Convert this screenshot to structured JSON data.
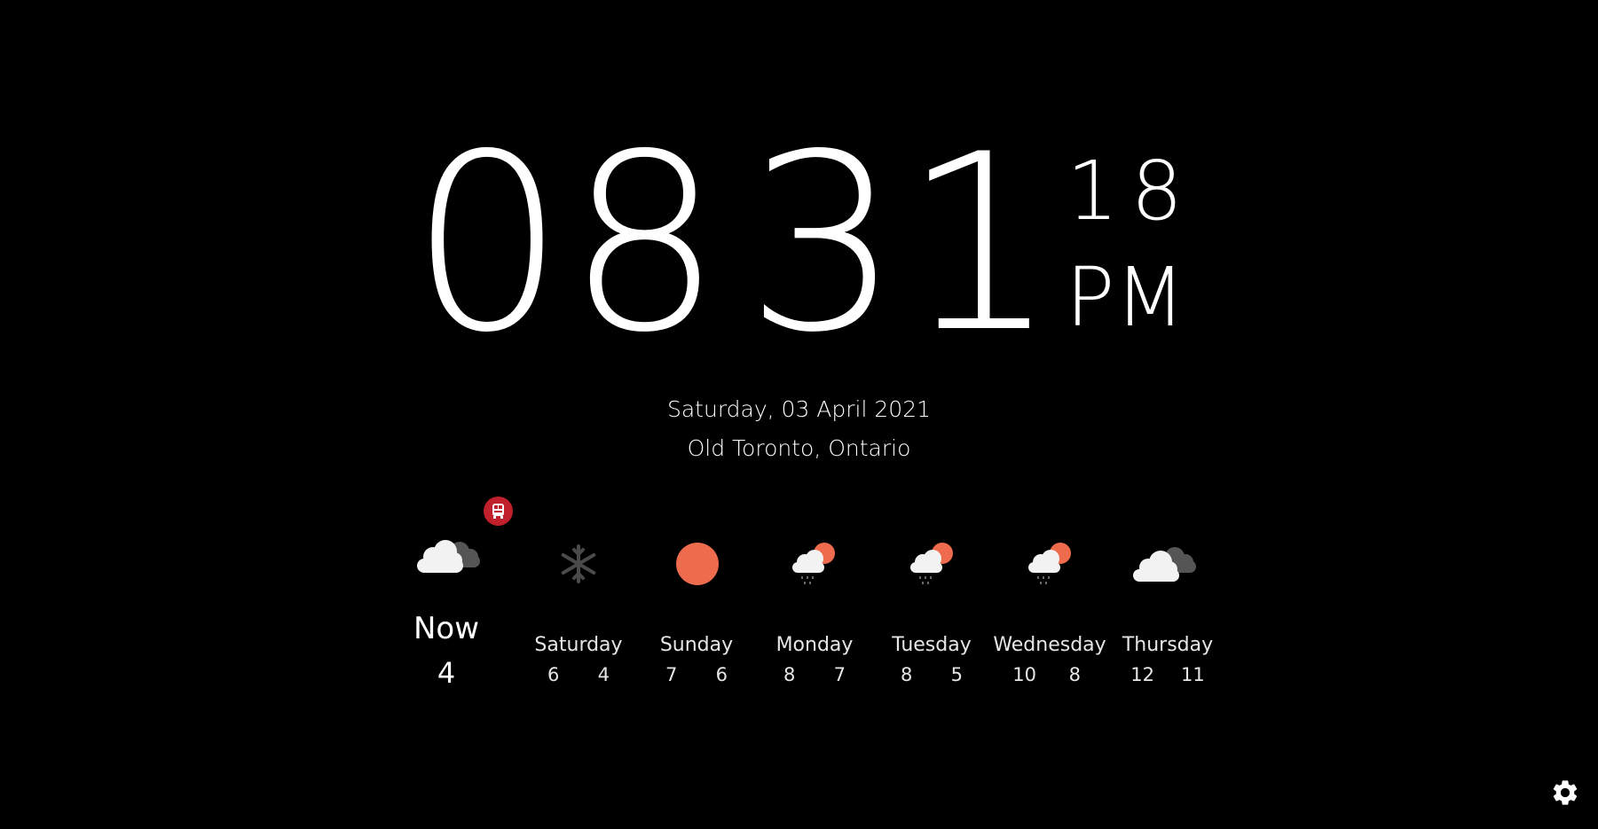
{
  "clock": {
    "hours": "08",
    "minutes": "31",
    "seconds": "18",
    "ampm": "PM"
  },
  "date": "Saturday, 03 April 2021",
  "location": "Old Toronto, Ontario",
  "now": {
    "label": "Now",
    "temp": "4",
    "icon": "cloudy-icon",
    "alert_icon": "train-alert-icon"
  },
  "forecast": [
    {
      "day": "Saturday",
      "high": "6",
      "low": "4",
      "icon": "snow-icon"
    },
    {
      "day": "Sunday",
      "high": "7",
      "low": "6",
      "icon": "sun-icon"
    },
    {
      "day": "Monday",
      "high": "8",
      "low": "7",
      "icon": "sun-cloud-rain-icon"
    },
    {
      "day": "Tuesday",
      "high": "8",
      "low": "5",
      "icon": "sun-cloud-rain-icon"
    },
    {
      "day": "Wednesday",
      "high": "10",
      "low": "8",
      "icon": "sun-cloud-rain-icon"
    },
    {
      "day": "Thursday",
      "high": "12",
      "low": "11",
      "icon": "cloudy-icon"
    }
  ],
  "settings_icon": "gear-icon",
  "colors": {
    "background": "#000000",
    "text": "#ffffff",
    "sun": "#ee6c4d",
    "cloud_light": "#f2f2f2",
    "cloud_dark": "#555555",
    "alert": "#c0202b"
  }
}
